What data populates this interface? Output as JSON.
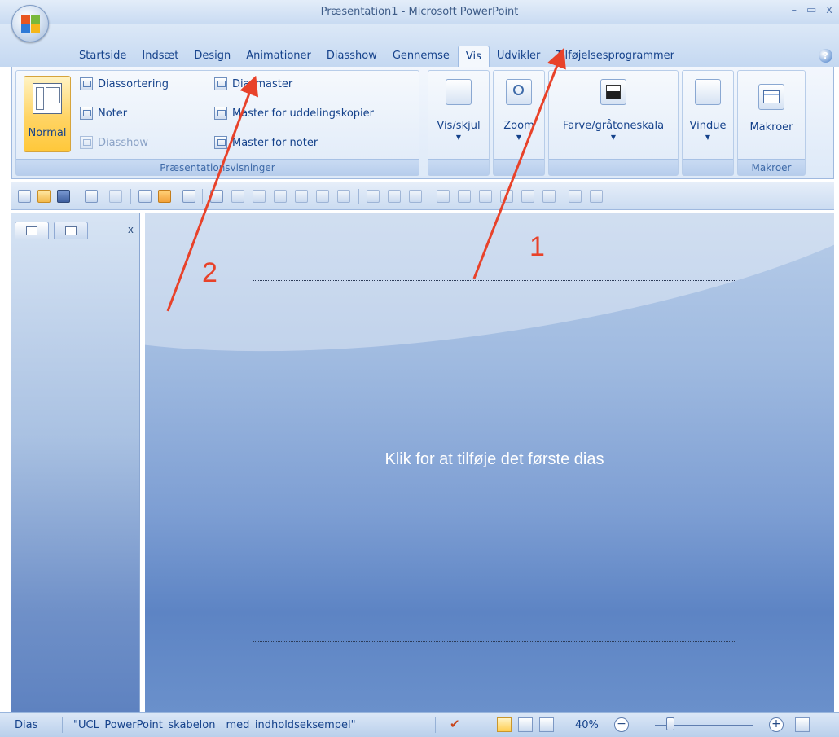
{
  "window": {
    "title": "Præsentation1 - Microsoft PowerPoint",
    "minimize": "–",
    "maximize": "▭",
    "close": "x"
  },
  "tabs": [
    "Startside",
    "Indsæt",
    "Design",
    "Animationer",
    "Diasshow",
    "Gennemse",
    "Vis",
    "Udvikler",
    "Tilføjelsesprogrammer"
  ],
  "active_tab": "Vis",
  "help": "?",
  "ribbon": {
    "presentation_views": {
      "label": "Præsentationsvisninger",
      "normal": "Normal",
      "slide_sorter": "Diassortering",
      "notes": "Noter",
      "slideshow": "Diasshow",
      "slide_master": "Diasmaster",
      "handout_master": "Master for uddelingskopier",
      "notes_master": "Master for noter"
    },
    "show_hide": "Vis/skjul",
    "zoom": "Zoom",
    "color_grayscale": "Farve/gråtoneskala",
    "window": "Vindue",
    "macros": "Makroer",
    "macros_group_label": "Makroer"
  },
  "left_panel": {
    "close": "x"
  },
  "slide": {
    "placeholder": "Klik for at tilføje det første dias"
  },
  "annotations": {
    "one": "1",
    "two": "2",
    "color": "#e8422a"
  },
  "statusbar": {
    "slide": "Dias",
    "theme": "\"UCL_PowerPoint_skabelon__med_indholdseksempel\"",
    "zoom": "40%",
    "zoom_out": "−",
    "zoom_in": "+"
  }
}
